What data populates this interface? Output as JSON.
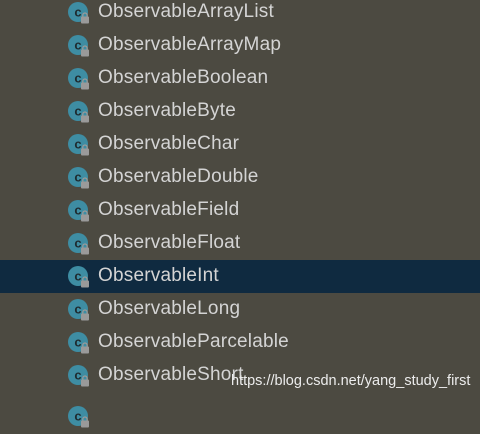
{
  "tree": {
    "items": [
      {
        "label": "ObservableArrayList",
        "selected": false,
        "icon": "class-icon"
      },
      {
        "label": "ObservableArrayMap",
        "selected": false,
        "icon": "class-icon"
      },
      {
        "label": "ObservableBoolean",
        "selected": false,
        "icon": "class-icon"
      },
      {
        "label": "ObservableByte",
        "selected": false,
        "icon": "class-icon"
      },
      {
        "label": "ObservableChar",
        "selected": false,
        "icon": "class-icon"
      },
      {
        "label": "ObservableDouble",
        "selected": false,
        "icon": "class-icon"
      },
      {
        "label": "ObservableField",
        "selected": false,
        "icon": "class-icon"
      },
      {
        "label": "ObservableFloat",
        "selected": false,
        "icon": "class-icon"
      },
      {
        "label": "ObservableInt",
        "selected": true,
        "icon": "class-icon"
      },
      {
        "label": "ObservableLong",
        "selected": false,
        "icon": "class-icon"
      },
      {
        "label": "ObservableParcelable",
        "selected": false,
        "icon": "class-icon"
      },
      {
        "label": "ObservableShort",
        "selected": false,
        "icon": "class-icon"
      }
    ]
  },
  "watermark": "https://blog.csdn.net/yang_study_first",
  "colors": {
    "background": "#4c4a41",
    "selected_row": "#0f2a40",
    "class_icon": "#3e8da3",
    "text": "#d4d4d4"
  }
}
